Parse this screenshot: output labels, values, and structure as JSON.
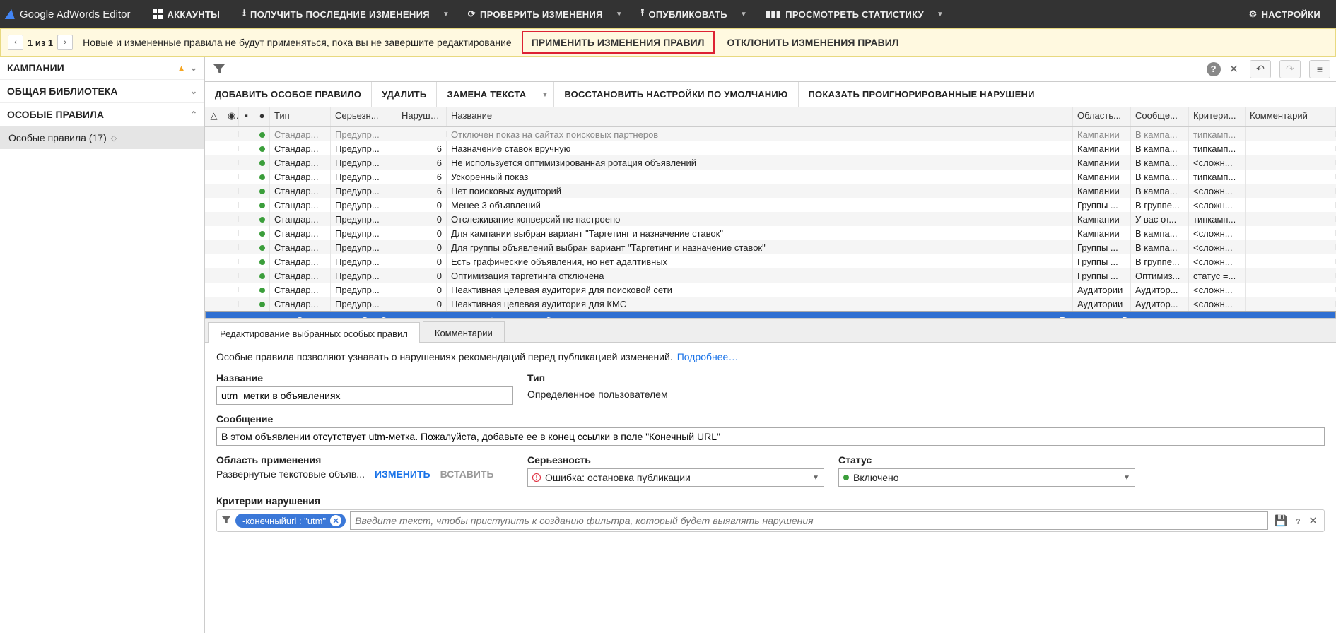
{
  "top": {
    "title": "Google AdWords Editor",
    "accounts": "АККАУНТЫ",
    "get": "ПОЛУЧИТЬ ПОСЛЕДНИЕ ИЗМЕНЕНИЯ",
    "check": "ПРОВЕРИТЬ ИЗМЕНЕНИЯ",
    "publish": "ОПУБЛИКОВАТЬ",
    "stats": "ПРОСМОТРЕТЬ СТАТИСТИКУ",
    "settings": "НАСТРОЙКИ"
  },
  "notice": {
    "count": "1 из 1",
    "msg": "Новые и измененные правила не будут применяться, пока вы не завершите редактирование",
    "apply": "ПРИМЕНИТЬ ИЗМЕНЕНИЯ ПРАВИЛ",
    "reject": "ОТКЛОНИТЬ ИЗМЕНЕНИЯ ПРАВИЛ"
  },
  "side": {
    "camp": "КАМПАНИИ",
    "lib": "ОБЩАЯ БИБЛИОТЕКА",
    "rules": "ОСОБЫЕ ПРАВИЛА",
    "item": "Особые правила (17)"
  },
  "actions": {
    "add": "ДОБАВИТЬ ОСОБОЕ ПРАВИЛО",
    "del": "УДАЛИТЬ",
    "replace": "ЗАМЕНА ТЕКСТА",
    "restore": "ВОССТАНОВИТЬ НАСТРОЙКИ ПО УМОЛЧАНИЮ",
    "show_ign": "ПОКАЗАТЬ ПРОИГНОРИРОВАННЫЕ НАРУШЕНИ"
  },
  "cols": {
    "type": "Тип",
    "sev": "Серьезн...",
    "vio": "Наруше...",
    "title": "Название",
    "scope": "Область...",
    "msg": "Сообще...",
    "crit": "Критери...",
    "comm": "Комментарий"
  },
  "rows": [
    {
      "cut": true,
      "type": "Стандар...",
      "sev": "Предупр...",
      "vio": "",
      "title": "Отключен показ на сайтах поисковых партнеров",
      "scope": "Кампании",
      "msg": "В кампа...",
      "crit": "типкамп..."
    },
    {
      "type": "Стандар...",
      "sev": "Предупр...",
      "vio": "6",
      "title": "Назначение ставок вручную",
      "scope": "Кампании",
      "msg": "В кампа...",
      "crit": "типкамп..."
    },
    {
      "type": "Стандар...",
      "sev": "Предупр...",
      "vio": "6",
      "title": "Не используется оптимизированная ротация объявлений",
      "scope": "Кампании",
      "msg": "В кампа...",
      "crit": "<сложн..."
    },
    {
      "type": "Стандар...",
      "sev": "Предупр...",
      "vio": "6",
      "title": "Ускоренный показ",
      "scope": "Кампании",
      "msg": "В кампа...",
      "crit": "типкамп..."
    },
    {
      "type": "Стандар...",
      "sev": "Предупр...",
      "vio": "6",
      "title": "Нет поисковых аудиторий",
      "scope": "Кампании",
      "msg": "В кампа...",
      "crit": "<сложн..."
    },
    {
      "type": "Стандар...",
      "sev": "Предупр...",
      "vio": "0",
      "title": "Менее 3 объявлений",
      "scope": "Группы ...",
      "msg": "В группе...",
      "crit": "<сложн..."
    },
    {
      "type": "Стандар...",
      "sev": "Предупр...",
      "vio": "0",
      "title": "Отслеживание конверсий не настроено",
      "scope": "Кампании",
      "msg": "У вас от...",
      "crit": "типкамп..."
    },
    {
      "type": "Стандар...",
      "sev": "Предупр...",
      "vio": "0",
      "title": "Для кампании выбран вариант \"Таргетинг и назначение ставок\"",
      "scope": "Кампании",
      "msg": "В кампа...",
      "crit": "<сложн..."
    },
    {
      "type": "Стандар...",
      "sev": "Предупр...",
      "vio": "0",
      "title": "Для группы объявлений выбран вариант \"Таргетинг и назначение ставок\"",
      "scope": "Группы ...",
      "msg": "В кампа...",
      "crit": "<сложн..."
    },
    {
      "type": "Стандар...",
      "sev": "Предупр...",
      "vio": "0",
      "title": "Есть графические объявления, но нет адаптивных",
      "scope": "Группы ...",
      "msg": "В группе...",
      "crit": "<сложн..."
    },
    {
      "type": "Стандар...",
      "sev": "Предупр...",
      "vio": "0",
      "title": "Оптимизация таргетинга отключена",
      "scope": "Группы ...",
      "msg": "Оптимиз...",
      "crit": "статус =..."
    },
    {
      "type": "Стандар...",
      "sev": "Предупр...",
      "vio": "0",
      "title": "Неактивная целевая аудитория для поисковой сети",
      "scope": "Аудитории",
      "msg": "Аудитор...",
      "crit": "<сложн..."
    },
    {
      "type": "Стандар...",
      "sev": "Предупр...",
      "vio": "0",
      "title": "Неактивная целевая аудитория для КМС",
      "scope": "Аудитории",
      "msg": "Аудитор...",
      "crit": "<сложн..."
    },
    {
      "sel": true,
      "warn": true,
      "type": "Опреде...",
      "sev": "Ошибка:...",
      "vio": "-",
      "title": "utm_метки в объявлениях",
      "scope": "Разверну...",
      "msg": "В этом о...",
      "crit": "-конеч..."
    }
  ],
  "tabs": {
    "edit": "Редактирование выбранных особых правил",
    "comm": "Комментарии"
  },
  "editor": {
    "desc": "Особые правила позволяют узнавать о нарушениях рекомендаций перед публикацией изменений.",
    "more": "Подробнее…",
    "name_l": "Название",
    "name_v": "utm_метки в объявлениях",
    "type_l": "Тип",
    "type_v": "Определенное пользователем",
    "msg_l": "Сообщение",
    "msg_v": "В этом объявлении отсутствует utm-метка. Пожалуйста, добавьте ее в конец ссылки в поле \"Конечный URL\"",
    "scope_l": "Область применения",
    "scope_v": "Развернутые текстовые объяв...",
    "change": "ИЗМЕНИТЬ",
    "paste": "ВСТАВИТЬ",
    "sev_l": "Серьезность",
    "sev_v": "Ошибка: остановка публикации",
    "status_l": "Статус",
    "status_v": "Включено",
    "crit_l": "Критерии нарушения",
    "chip": "-конечныйurl : \"utm\"",
    "ph": "Введите текст, чтобы приступить к созданию фильтра, который будет выявлять нарушения"
  }
}
